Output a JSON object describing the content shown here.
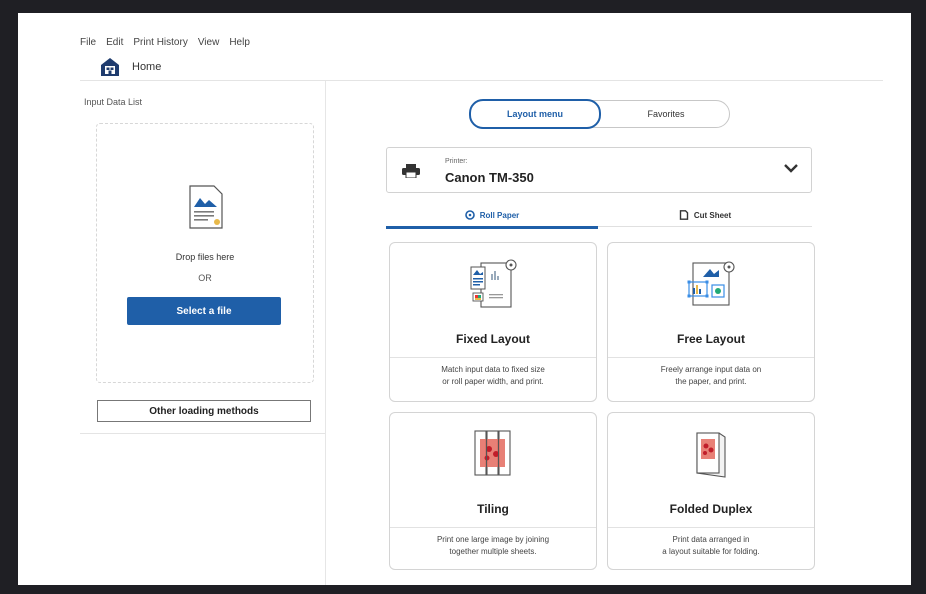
{
  "menu": [
    "File",
    "Edit",
    "Print History",
    "View",
    "Help"
  ],
  "home": {
    "label": "Home"
  },
  "left_panel": {
    "title": "Input Data List",
    "drop_text": "Drop files here",
    "or_text": "OR",
    "select_label": "Select a file",
    "other_label": "Other loading methods"
  },
  "toggle": {
    "active": "Layout menu",
    "other": "Favorites"
  },
  "printer": {
    "label": "Printer:",
    "name": "Canon TM-350"
  },
  "tabs": [
    {
      "label": "Roll Paper",
      "icon": "roll-paper-icon"
    },
    {
      "label": "Cut Sheet",
      "icon": "cut-sheet-icon"
    }
  ],
  "cards": [
    {
      "title": "Fixed Layout",
      "desc1": "Match input data to fixed size",
      "desc2": "or roll paper width, and print."
    },
    {
      "title": "Free Layout",
      "desc1": "Freely arrange input data on",
      "desc2": "the paper, and print."
    },
    {
      "title": "Tiling",
      "desc1": "Print one large image by joining",
      "desc2": "together multiple sheets."
    },
    {
      "title": "Folded Duplex",
      "desc1": "Print data arranged in",
      "desc2": "a layout suitable for folding."
    }
  ],
  "colors": {
    "accent": "#1f5fa8",
    "frame": "#1f1f24"
  }
}
